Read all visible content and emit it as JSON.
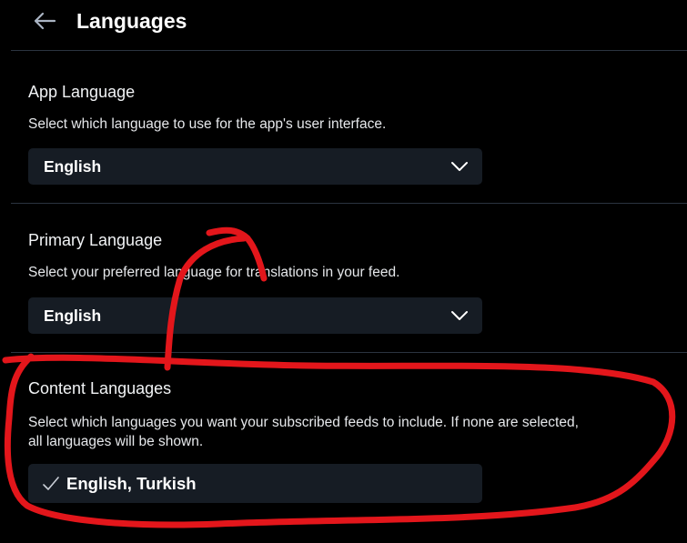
{
  "header": {
    "title": "Languages",
    "back_icon": "arrow-left-icon"
  },
  "app_language": {
    "title": "App Language",
    "description": "Select which language to use for the app's user interface.",
    "selected": "English"
  },
  "primary_language": {
    "title": "Primary Language",
    "description": "Select your preferred language for translations in your feed.",
    "selected": "English"
  },
  "content_languages": {
    "title": "Content Languages",
    "description_line1": "Select which languages you want your subscribed feeds to include. If none are selected,",
    "description_line2": "all languages will be shown.",
    "selected": "English, Turkish",
    "icon": "check-icon"
  },
  "colors": {
    "background": "#000000",
    "control_background": "#161c24",
    "divider": "#2b3440",
    "annotation": "#e3161b"
  }
}
